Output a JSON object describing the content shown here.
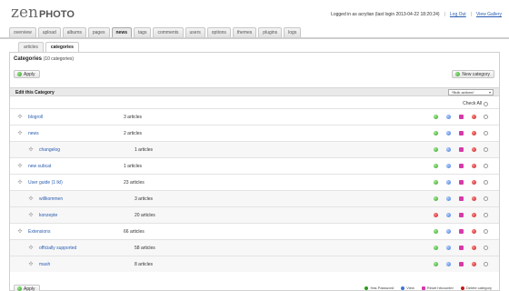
{
  "header": {
    "logo_zen": "zen",
    "logo_photo": "PHOTO",
    "login_text": "Logged in as acrylian (last login 2013-04-22 18:20:24)",
    "logout_label": "Log Out",
    "view_gallery_label": "View Gallery"
  },
  "tabs": [
    {
      "label": "overview",
      "active": false
    },
    {
      "label": "upload",
      "active": false
    },
    {
      "label": "albums",
      "active": false
    },
    {
      "label": "pages",
      "active": false
    },
    {
      "label": "news",
      "active": true
    },
    {
      "label": "tags",
      "active": false
    },
    {
      "label": "comments",
      "active": false
    },
    {
      "label": "users",
      "active": false
    },
    {
      "label": "options",
      "active": false
    },
    {
      "label": "themes",
      "active": false
    },
    {
      "label": "plugins",
      "active": false
    },
    {
      "label": "logs",
      "active": false
    }
  ],
  "subtabs": [
    {
      "label": "articles",
      "active": false
    },
    {
      "label": "categories",
      "active": true
    }
  ],
  "page": {
    "title": "Categories",
    "count": "(10 categories)",
    "apply_label": "Apply",
    "new_category_label": "New category",
    "table_header": "Edit this Category",
    "bulk_placeholder": "*Bulk actions*",
    "check_all_label": "Check All"
  },
  "categories": [
    {
      "name": "blogroll",
      "articles": "3 articles",
      "level": 0,
      "published": true
    },
    {
      "name": "news",
      "articles": "2 articles",
      "level": 0,
      "published": true
    },
    {
      "name": "changelog",
      "articles": "1 articles",
      "level": 1,
      "published": true
    },
    {
      "name": "new subcat",
      "articles": "1 articles",
      "level": 0,
      "published": true
    },
    {
      "name": "User guide (1 lkl)",
      "articles": "23 articles",
      "level": 0,
      "published": true
    },
    {
      "name": "willkommen",
      "articles": "3 articles",
      "level": 1,
      "published": true
    },
    {
      "name": "konzepte",
      "articles": "20 articles",
      "level": 1,
      "published": false
    },
    {
      "name": "Extensions",
      "articles": "66 articles",
      "level": 0,
      "published": true
    },
    {
      "name": "officially supported",
      "articles": "58 articles",
      "level": 1,
      "published": true
    },
    {
      "name": "mash",
      "articles": "8 articles",
      "level": 1,
      "published": true
    }
  ],
  "legend": {
    "has_password": "Has Password",
    "view": "View",
    "reset_hitcounter": "Reset hitcounter",
    "delete_category": "Delete category"
  },
  "colors": {
    "link": "#2a5db0",
    "published": "#2c9a1f",
    "unpublished": "#c41818",
    "view": "#3e73d6",
    "reset": "#d63aa8"
  }
}
